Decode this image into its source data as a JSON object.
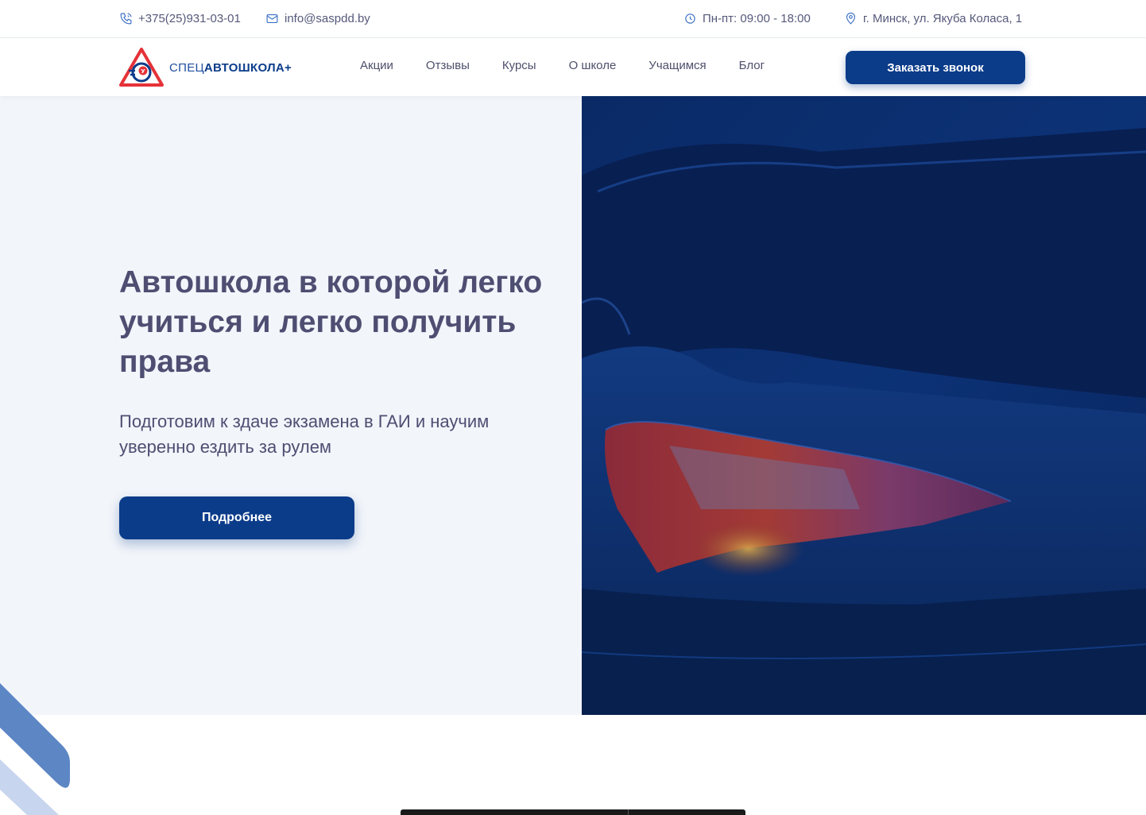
{
  "topbar": {
    "phone": "+375(25)931-03-01",
    "email": "info@saspdd.by",
    "hours": "Пн-пт: 09:00 - 18:00",
    "address": "г. Минск, ул. Якуба Коласа, 1"
  },
  "header": {
    "logo_text_light": "СПЕЦ",
    "logo_text_bold": "АВТОШКОЛА+",
    "logo_badge": "У",
    "nav": [
      "Акции",
      "Отзывы",
      "Курсы",
      "О школе",
      "Учащимся",
      "Блог"
    ],
    "cta_label": "Заказать звонок"
  },
  "hero": {
    "title": "Автошкола в которой легко учиться и легко получить права",
    "subtitle": "Подготовим к здаче экзамена в ГАИ и научим уверенно ездить за рулем",
    "button_label": "Подробнее"
  },
  "colors": {
    "brand": "#0b3c8a",
    "hero_bg": "#f2f5fa",
    "text": "#4e4e72",
    "logo_red": "#e53238"
  }
}
